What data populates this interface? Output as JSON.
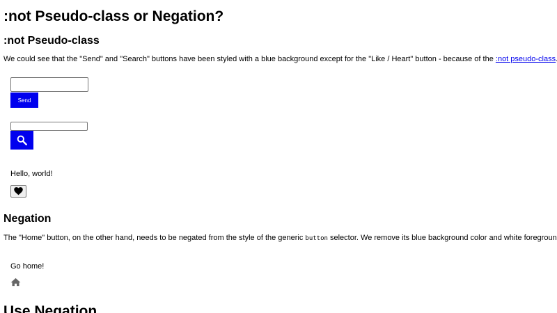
{
  "page": {
    "title": ":not Pseudo-class or Negation?",
    "bottom_heading": "Use Negation"
  },
  "not_section": {
    "heading": ":not Pseudo-class",
    "intro_text": "We could see that the \"Send\" and \"Search\" buttons have been styled with a blue background except for the \"Like / Heart\" button - because of the ",
    "link_text": ":not pseudo-class",
    "intro_end": ".",
    "send_label": "Send",
    "hello_text": "Hello, world!"
  },
  "negation_section": {
    "heading": "Negation",
    "text_before": "The \"Home\" button, on the other hand, needs to be negated from the style of the generic ",
    "code_text": "button",
    "text_after": " selector. We remove its blue background color and white foreground color.",
    "home_text": "Go home!"
  },
  "icons": {
    "search": "search-icon",
    "heart": "heart-icon",
    "home": "home-icon"
  },
  "colors": {
    "button_blue": "#0000ee",
    "link": "#0000ee",
    "home_icon": "#666666"
  }
}
